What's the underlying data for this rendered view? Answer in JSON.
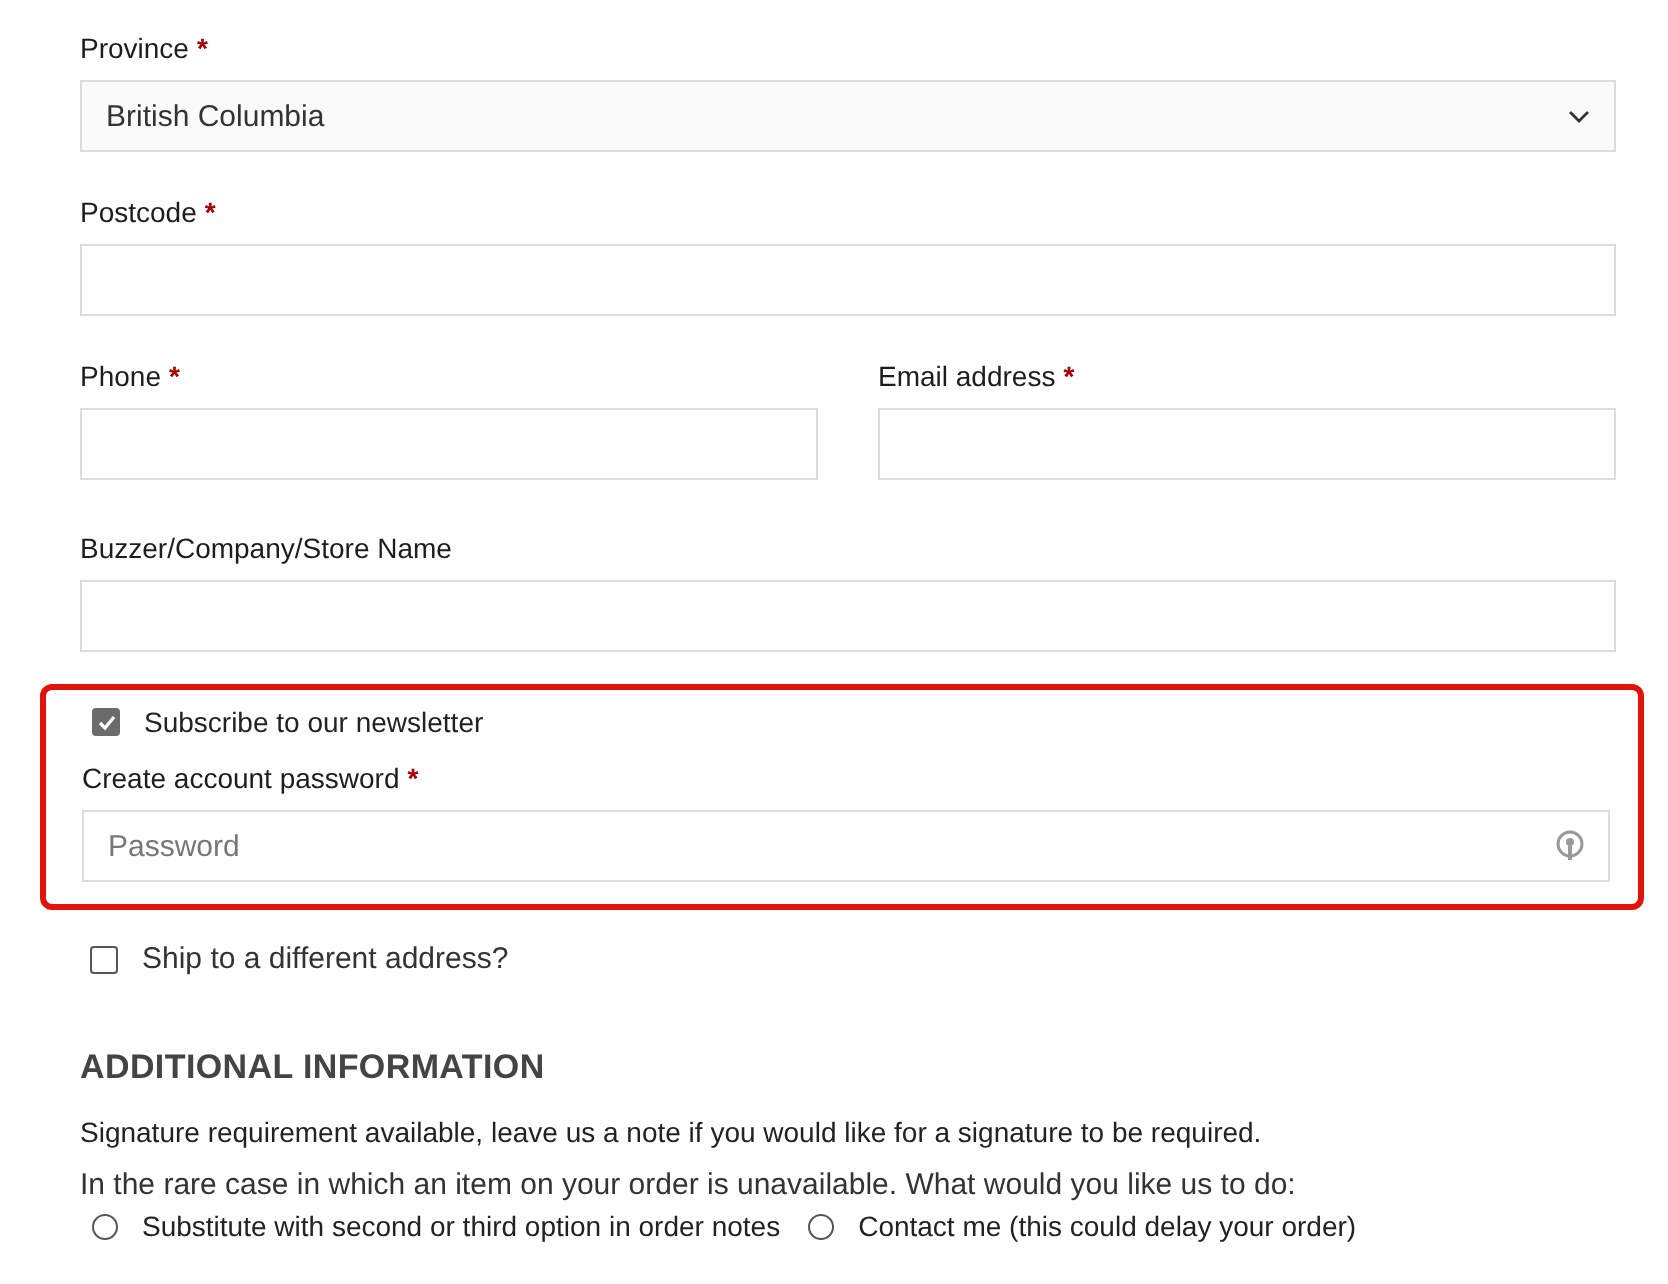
{
  "fields_top": [
    {
      "kind": "select",
      "label": "Province",
      "required_mark": "*",
      "value": "British Columbia"
    },
    {
      "kind": "input",
      "label": "Postcode",
      "required_mark": "*"
    }
  ],
  "fields_pair": [
    {
      "kind": "input",
      "label": "Phone",
      "required_mark": "*"
    },
    {
      "kind": "input",
      "label": "Email address",
      "required_mark": "*"
    }
  ],
  "fields_bottom": [
    {
      "kind": "input",
      "label": "Buzzer/Company/Store Name"
    }
  ],
  "highlight": {
    "newsletter": {
      "label": "Subscribe to our newsletter",
      "checked": true
    },
    "password": {
      "kind": "password",
      "label": "Create account password",
      "required_mark": "*",
      "placeholder": "Password"
    }
  },
  "ship_different": {
    "label": "Ship to a different address?",
    "checked": false
  },
  "additional": {
    "heading": "ADDITIONAL INFORMATION",
    "note": "Signature requirement available, leave us a note if you would like for a signature to be required.",
    "question": "In the rare case in which an item on your order is unavailable. What would you like us to do:",
    "options": [
      {
        "label": "Substitute with second or third option in order notes",
        "selected": false
      },
      {
        "label": "Contact me (this could delay your order)",
        "selected": false
      }
    ]
  }
}
